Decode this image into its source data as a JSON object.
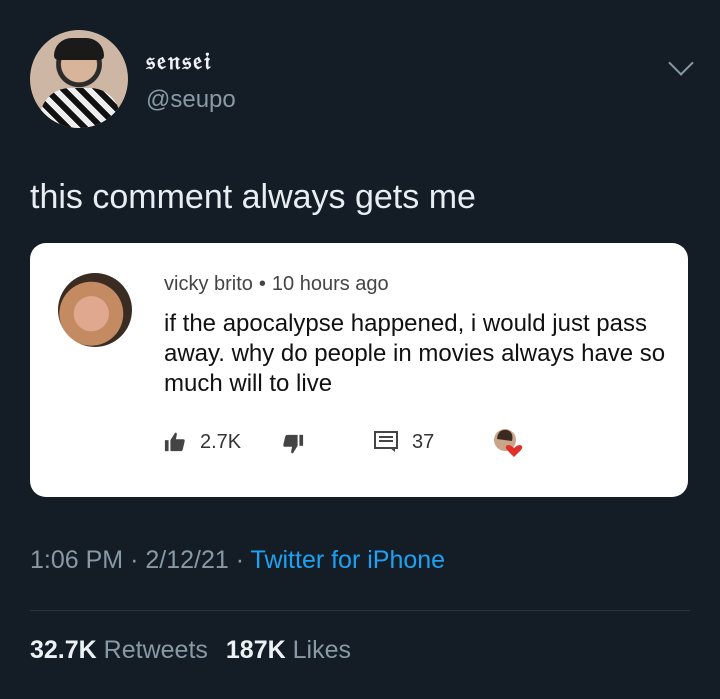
{
  "author": {
    "display_name": "𝔰𝔢𝔫𝔰𝔢𝔦",
    "handle": "@seupo"
  },
  "tweet": {
    "text": "this comment always gets me"
  },
  "comment": {
    "author": "vicky brito",
    "separator": "•",
    "time": "10 hours ago",
    "body": "if the apocalypse happened, i would just pass away. why do people in movies always have so much will to live",
    "likes": "2.7K",
    "replies": "37"
  },
  "meta": {
    "time": "1:06 PM",
    "sep1": "·",
    "date": "2/12/21",
    "sep2": "·",
    "source": "Twitter for iPhone"
  },
  "stats": {
    "retweets_count": "32.7K",
    "retweets_label": "Retweets",
    "likes_count": "187K",
    "likes_label": "Likes"
  },
  "colors": {
    "background": "#141d26",
    "link": "#1da1f2",
    "muted": "#8899a6"
  },
  "icons": [
    "chevron-down-icon",
    "thumbs-up-icon",
    "thumbs-down-icon",
    "reply-icon",
    "heart-icon"
  ]
}
